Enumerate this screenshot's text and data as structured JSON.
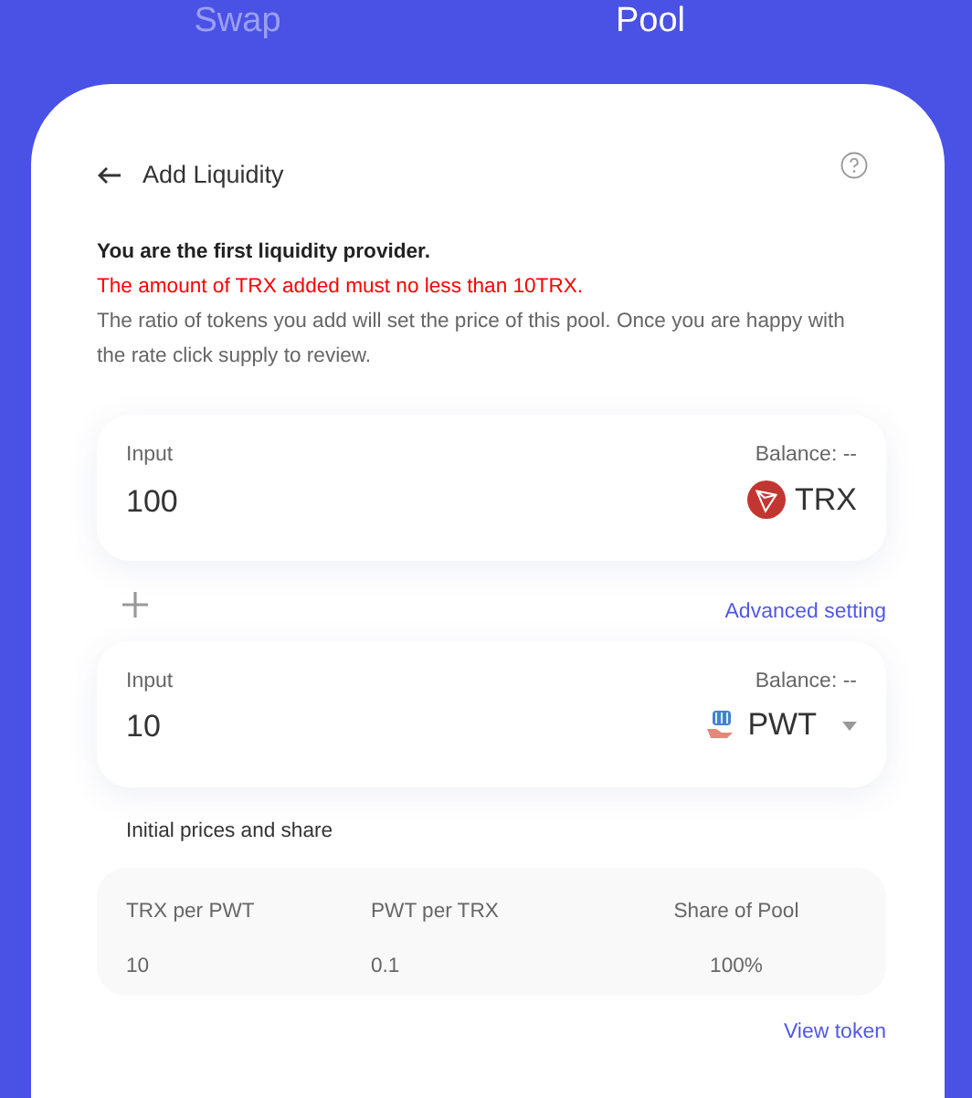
{
  "tabs": [
    {
      "label": "Swap",
      "selected": false
    },
    {
      "label": "Pool",
      "selected": true
    }
  ],
  "header": {
    "title": "Add Liquidity"
  },
  "notice": {
    "heading": "You are the first liquidity provider.",
    "warning": "The amount of TRX added must no less than 10TRX.",
    "body": "The ratio of tokens you add will set the price of this pool. Once you are happy with the rate click supply to review."
  },
  "inputs": [
    {
      "label": "Input",
      "balance": "Balance: --",
      "value": "100",
      "token": "TRX",
      "kind": "trx",
      "dropdown": false
    },
    {
      "label": "Input",
      "balance": "Balance: --",
      "value": "10",
      "token": "PWT",
      "kind": "pwt",
      "dropdown": true
    }
  ],
  "advanced_link": "Advanced setting",
  "prices": {
    "title": "Initial prices and share",
    "columns": [
      {
        "label": "TRX per PWT",
        "value": "10"
      },
      {
        "label": "PWT per TRX",
        "value": "0.1"
      },
      {
        "label": "Share of Pool",
        "value": "100%"
      }
    ]
  },
  "view_token_link": "View token"
}
